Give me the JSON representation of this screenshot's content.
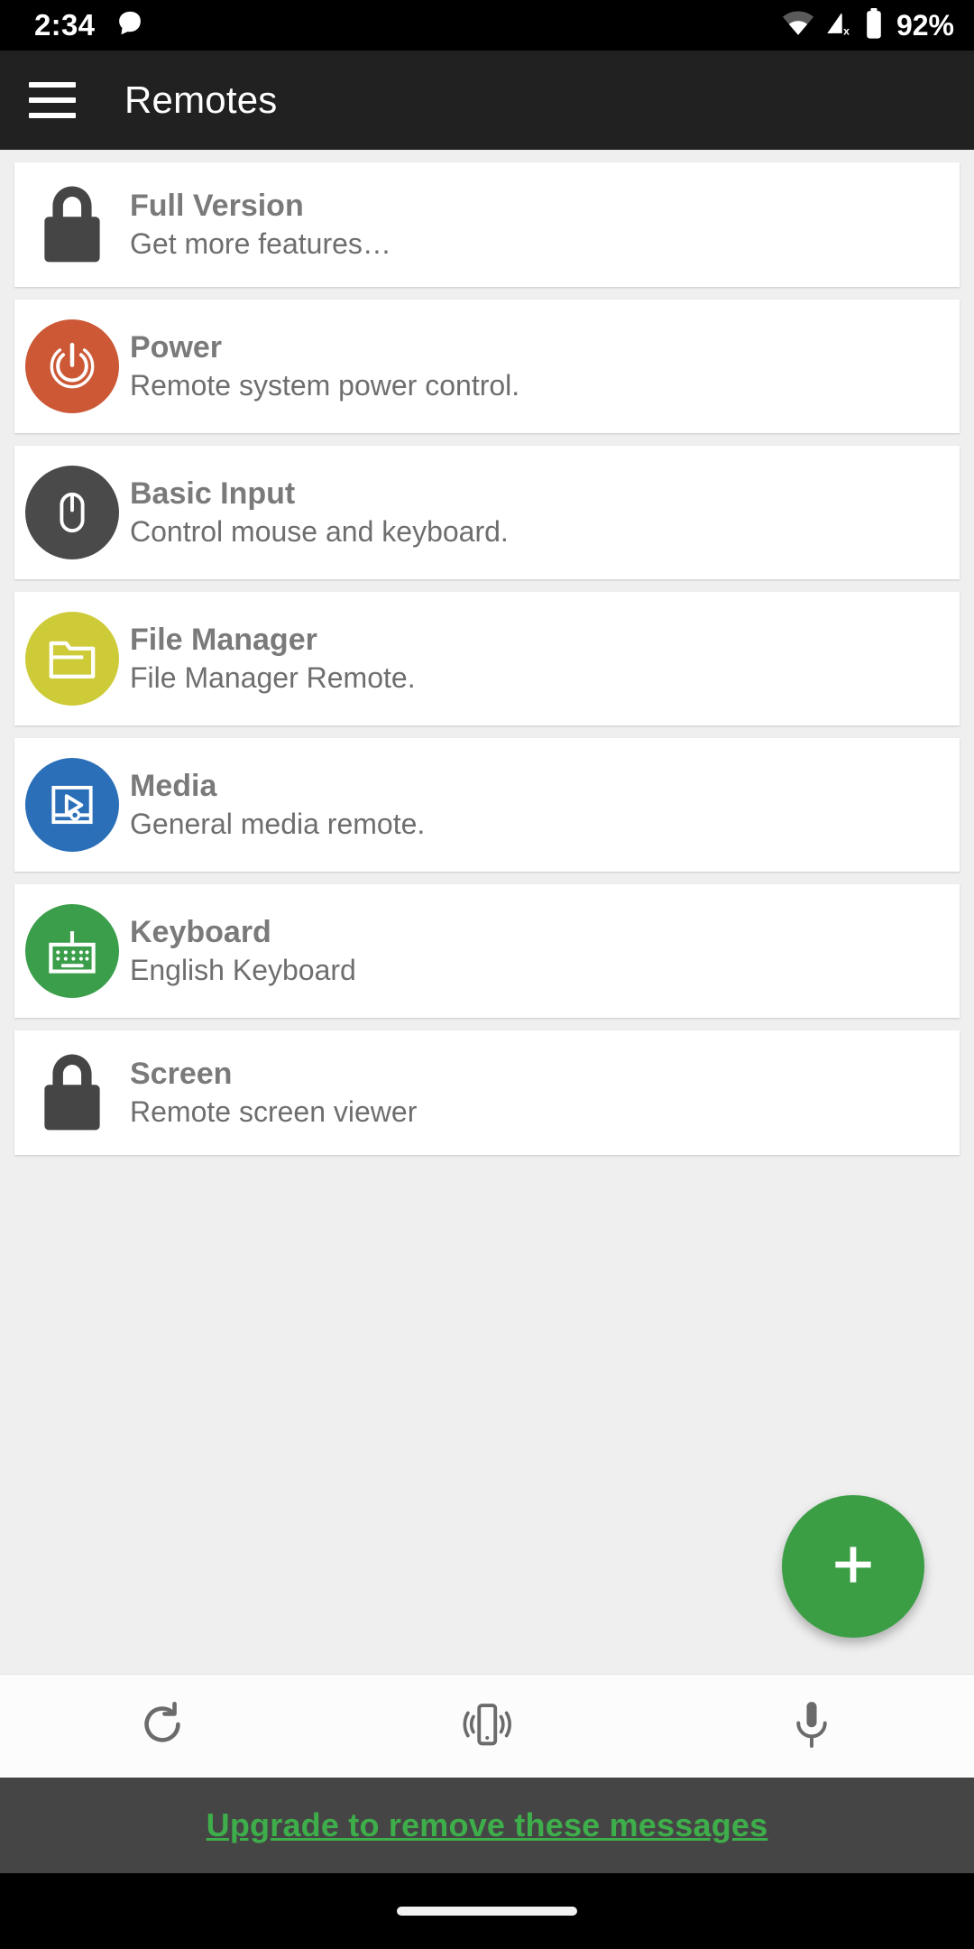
{
  "status_bar": {
    "time": "2:34",
    "battery_percent": "92%",
    "icons": [
      "notification-bubble-icon",
      "wifi-icon",
      "cellular-off-icon",
      "battery-icon"
    ]
  },
  "app_bar": {
    "menu_icon": "hamburger-menu-icon",
    "title": "Remotes"
  },
  "remotes": [
    {
      "title": "Full Version",
      "subtitle": "Get more features…",
      "icon": "lock-icon",
      "icon_style": "plain",
      "color": "#454545"
    },
    {
      "title": "Power",
      "subtitle": "Remote system power control.",
      "icon": "power-icon",
      "icon_style": "circle",
      "color": "#CC5836"
    },
    {
      "title": "Basic Input",
      "subtitle": "Control mouse and keyboard.",
      "icon": "mouse-icon",
      "icon_style": "circle",
      "color": "#4A4A4A"
    },
    {
      "title": "File Manager",
      "subtitle": "File Manager Remote.",
      "icon": "folder-icon",
      "icon_style": "circle",
      "color": "#CDCB38"
    },
    {
      "title": "Media",
      "subtitle": "General media remote.",
      "icon": "media-play-icon",
      "icon_style": "circle",
      "color": "#2A6FB8"
    },
    {
      "title": "Keyboard",
      "subtitle": "English Keyboard",
      "icon": "keyboard-icon",
      "icon_style": "circle",
      "color": "#3B9E4B"
    },
    {
      "title": "Screen",
      "subtitle": "Remote screen viewer",
      "icon": "lock-icon",
      "icon_style": "plain",
      "color": "#454545"
    }
  ],
  "fab": {
    "icon": "plus-icon",
    "label": "+",
    "color": "#3B9E45"
  },
  "bottom_toolbar": [
    {
      "icon": "refresh-icon",
      "name": "refresh-button"
    },
    {
      "icon": "vibrate-device-icon",
      "name": "vibrate-button"
    },
    {
      "icon": "microphone-icon",
      "name": "voice-button"
    }
  ],
  "banner": {
    "text": "Upgrade to remove these messages",
    "color": "#3EAE4A"
  },
  "nav_bar": {
    "gesture_pill": "gesture-pill"
  }
}
